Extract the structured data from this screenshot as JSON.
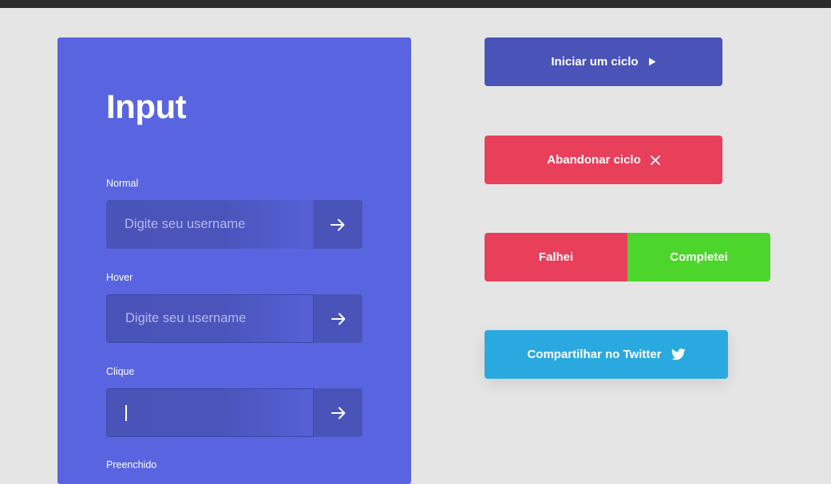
{
  "input_panel": {
    "title": "Input",
    "fields": [
      {
        "label": "Normal",
        "placeholder": "Digite seu username"
      },
      {
        "label": "Hover",
        "placeholder": "Digite seu username"
      },
      {
        "label": "Clique",
        "placeholder": ""
      },
      {
        "label": "Preenchido"
      }
    ]
  },
  "buttons": {
    "start_cycle": "Iniciar um ciclo",
    "abandon_cycle": "Abandonar ciclo",
    "failed": "Falhei",
    "completed": "Completei",
    "share_twitter": "Compartilhar no Twitter"
  },
  "icons": {
    "arrow": "arrow-right-icon",
    "play": "play-icon",
    "close": "close-icon",
    "twitter": "twitter-icon"
  },
  "colors": {
    "panel_bg": "#5965e0",
    "input_bg": "#4953b8",
    "danger": "#e83f5b",
    "success": "#4cd62b",
    "twitter": "#2aa9e0",
    "page_bg": "#e5e5e5"
  }
}
